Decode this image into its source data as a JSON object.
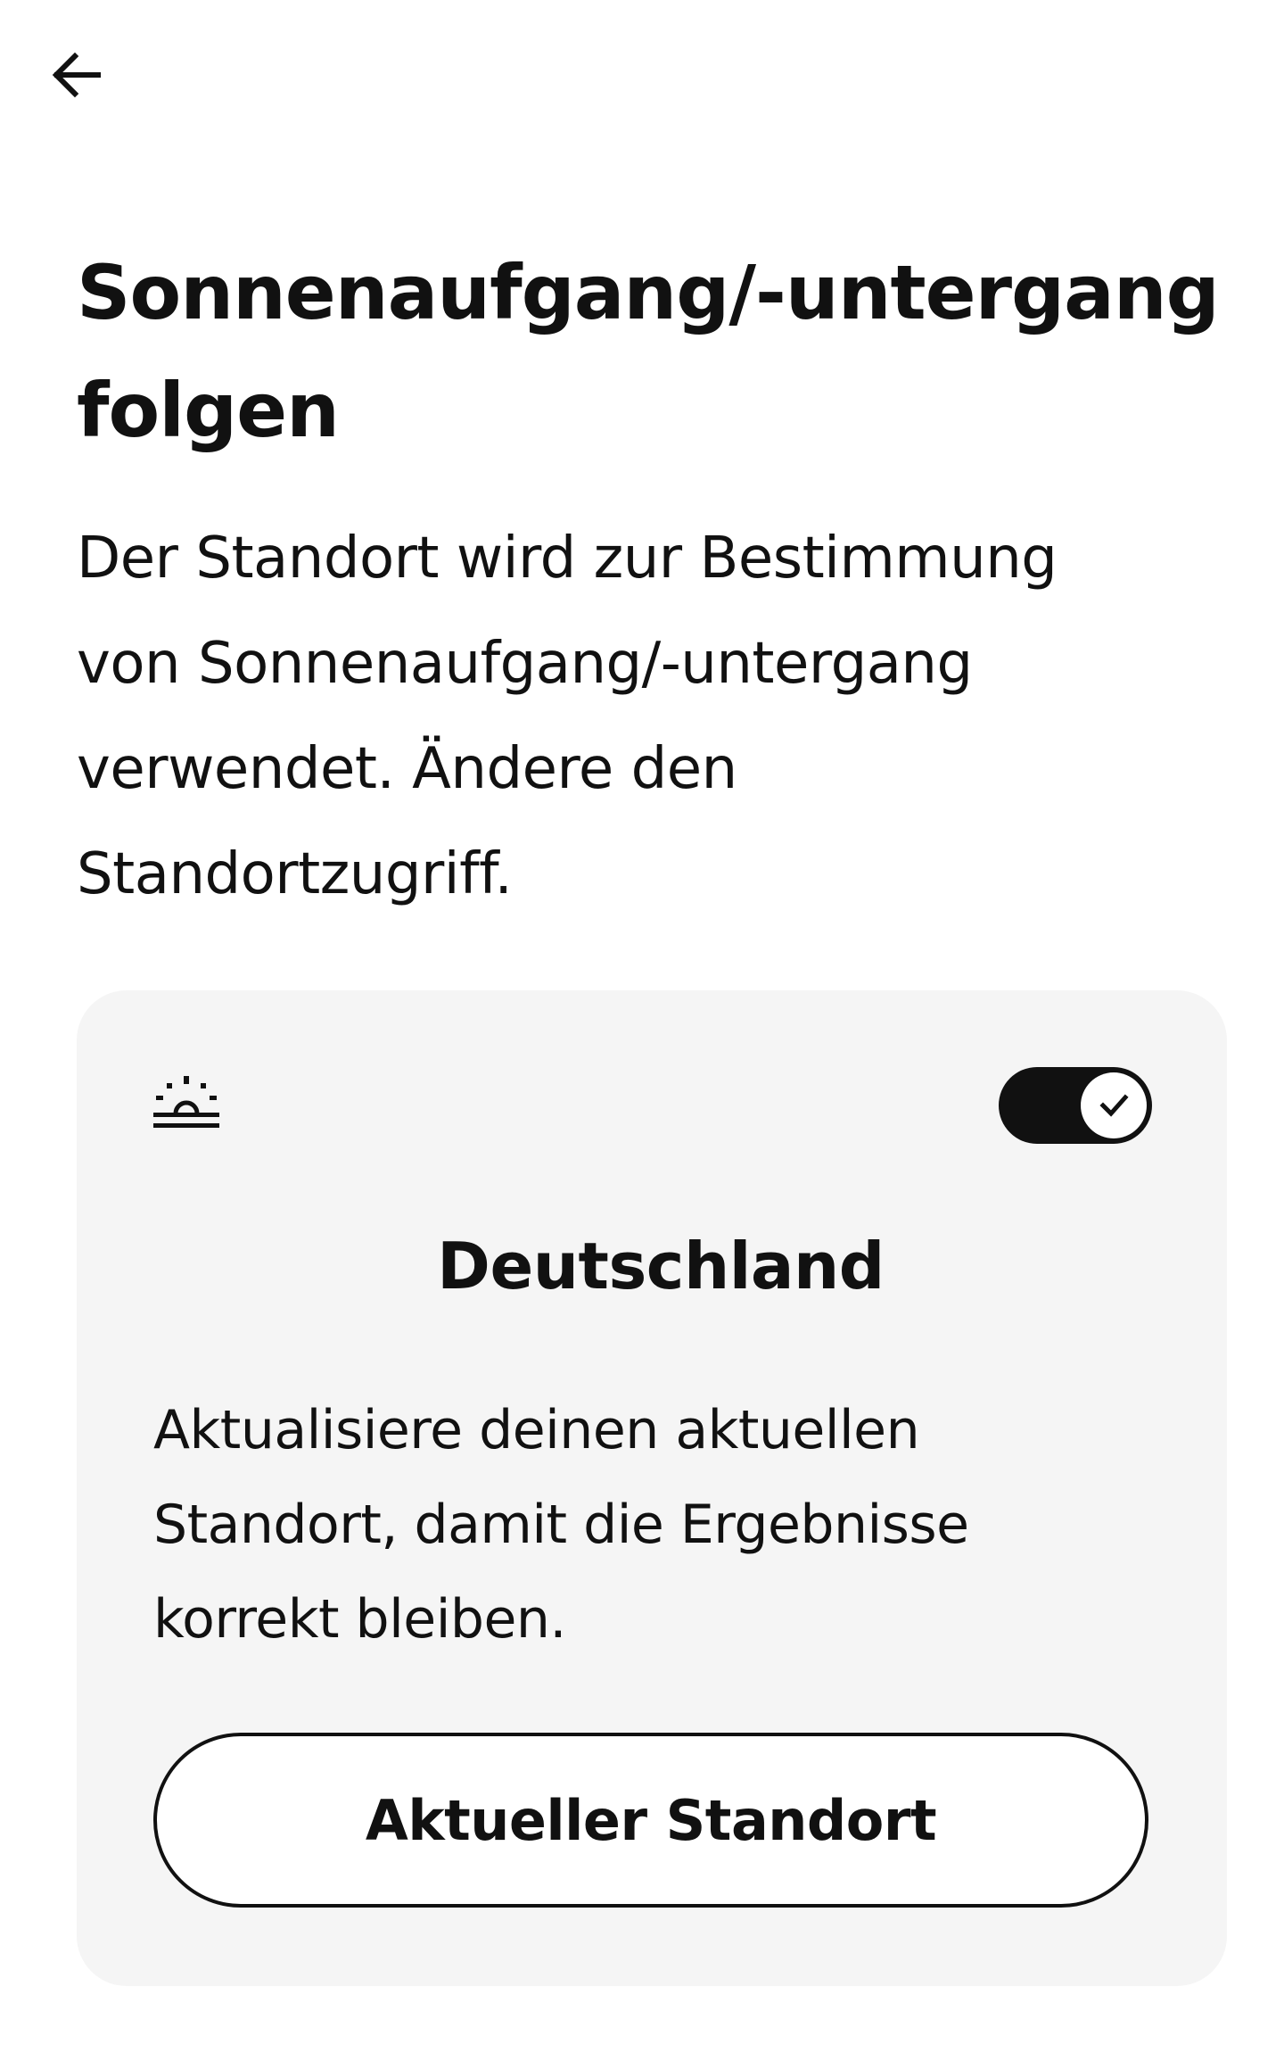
{
  "header": {
    "back_icon": "arrow-left-icon"
  },
  "page": {
    "title": "Sonnenaufgang/-untergang folgen",
    "description": "Der Standort wird zur Bestimmung von Sonnenaufgang/-untergang verwendet. Ändere den Standortzugriff."
  },
  "card": {
    "icon": "sunrise-icon",
    "toggle": {
      "state": "on",
      "icon": "check-icon"
    },
    "location_name": "Deutschland",
    "text": "Aktualisiere deinen aktuellen Standort, damit die Ergebnisse korrekt bleiben.",
    "button_label": "Aktueller Standort"
  },
  "colors": {
    "background": "#ffffff",
    "card_background": "#f5f5f5",
    "text": "#111111",
    "toggle_on": "#111111"
  }
}
